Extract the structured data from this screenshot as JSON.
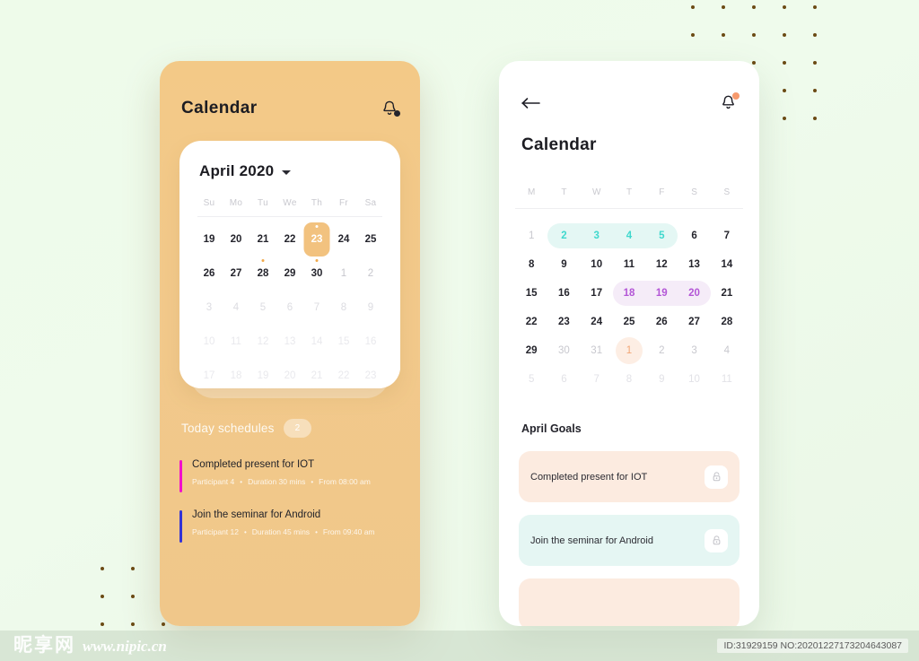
{
  "background": {
    "color": "#effbec",
    "dot_color": "#6b4a14"
  },
  "left_phone": {
    "accent_bg": "#f2c987",
    "title": "Calendar",
    "bell_icon": "bell-icon",
    "calendar": {
      "month_label": "April 2020",
      "dropdown_icon": "chevron-down-icon",
      "weekdays": [
        "Su",
        "Mo",
        "Tu",
        "We",
        "Th",
        "Fr",
        "Sa"
      ],
      "rows": [
        [
          {
            "n": "19",
            "style": "normal"
          },
          {
            "n": "20",
            "style": "normal"
          },
          {
            "n": "21",
            "style": "normal"
          },
          {
            "n": "22",
            "style": "normal"
          },
          {
            "n": "23",
            "style": "selected",
            "dot": true
          },
          {
            "n": "24",
            "style": "normal"
          },
          {
            "n": "25",
            "style": "normal"
          }
        ],
        [
          {
            "n": "26",
            "style": "normal"
          },
          {
            "n": "27",
            "style": "normal"
          },
          {
            "n": "28",
            "style": "normal",
            "dot": true
          },
          {
            "n": "29",
            "style": "normal"
          },
          {
            "n": "30",
            "style": "normal",
            "dot": true
          },
          {
            "n": "1",
            "style": "muted"
          },
          {
            "n": "2",
            "style": "muted"
          }
        ],
        [
          {
            "n": "3",
            "style": "faint"
          },
          {
            "n": "4",
            "style": "faint"
          },
          {
            "n": "5",
            "style": "faint"
          },
          {
            "n": "6",
            "style": "faint"
          },
          {
            "n": "7",
            "style": "faint"
          },
          {
            "n": "8",
            "style": "faint"
          },
          {
            "n": "9",
            "style": "faint"
          }
        ],
        [
          {
            "n": "10",
            "style": "fainter"
          },
          {
            "n": "11",
            "style": "fainter"
          },
          {
            "n": "12",
            "style": "fainter"
          },
          {
            "n": "13",
            "style": "fainter"
          },
          {
            "n": "14",
            "style": "fainter"
          },
          {
            "n": "15",
            "style": "fainter"
          },
          {
            "n": "16",
            "style": "fainter"
          }
        ],
        [
          {
            "n": "17",
            "style": "fainter"
          },
          {
            "n": "18",
            "style": "fainter"
          },
          {
            "n": "19",
            "style": "fainter"
          },
          {
            "n": "20",
            "style": "fainter"
          },
          {
            "n": "21",
            "style": "fainter"
          },
          {
            "n": "22",
            "style": "fainter"
          },
          {
            "n": "23",
            "style": "fainter"
          }
        ]
      ]
    },
    "schedules_section": {
      "title": "Today schedules",
      "count": "2",
      "items": [
        {
          "name": "Completed present for IOT",
          "participant": "Participant  4",
          "duration": "Duration 30 mins",
          "from": "From  08:00 am",
          "accent": "#f20fcc"
        },
        {
          "name": "Join the seminar for Android",
          "participant": "Participant  12",
          "duration": "Duration 45 mins",
          "from": "From  09:40 am",
          "accent": "#3333d6"
        }
      ]
    }
  },
  "right_phone": {
    "back_icon": "arrow-left-icon",
    "bell_icon": "bell-icon",
    "title": "Calendar",
    "calendar": {
      "weekdays": [
        "M",
        "T",
        "W",
        "T",
        "F",
        "S",
        "S"
      ],
      "rows": [
        [
          {
            "n": "1",
            "style": "muted"
          },
          {
            "n": "2",
            "style": "teal"
          },
          {
            "n": "3",
            "style": "teal"
          },
          {
            "n": "4",
            "style": "teal"
          },
          {
            "n": "5",
            "style": "teal"
          },
          {
            "n": "6",
            "style": "normal"
          },
          {
            "n": "7",
            "style": "normal"
          }
        ],
        [
          {
            "n": "8",
            "style": "normal"
          },
          {
            "n": "9",
            "style": "normal"
          },
          {
            "n": "10",
            "style": "normal"
          },
          {
            "n": "11",
            "style": "normal"
          },
          {
            "n": "12",
            "style": "normal"
          },
          {
            "n": "13",
            "style": "normal"
          },
          {
            "n": "14",
            "style": "normal"
          }
        ],
        [
          {
            "n": "15",
            "style": "normal"
          },
          {
            "n": "16",
            "style": "normal"
          },
          {
            "n": "17",
            "style": "normal"
          },
          {
            "n": "18",
            "style": "purple"
          },
          {
            "n": "19",
            "style": "purple"
          },
          {
            "n": "20",
            "style": "purple"
          },
          {
            "n": "21",
            "style": "normal"
          }
        ],
        [
          {
            "n": "22",
            "style": "normal"
          },
          {
            "n": "23",
            "style": "normal"
          },
          {
            "n": "24",
            "style": "normal"
          },
          {
            "n": "25",
            "style": "normal"
          },
          {
            "n": "26",
            "style": "normal"
          },
          {
            "n": "27",
            "style": "normal"
          },
          {
            "n": "28",
            "style": "normal"
          }
        ],
        [
          {
            "n": "29",
            "style": "normal"
          },
          {
            "n": "30",
            "style": "muted"
          },
          {
            "n": "31",
            "style": "muted"
          },
          {
            "n": "1",
            "style": "peach"
          },
          {
            "n": "2",
            "style": "muted"
          },
          {
            "n": "3",
            "style": "muted"
          },
          {
            "n": "4",
            "style": "muted"
          }
        ],
        [
          {
            "n": "5",
            "style": "faint"
          },
          {
            "n": "6",
            "style": "faint"
          },
          {
            "n": "7",
            "style": "faint"
          },
          {
            "n": "8",
            "style": "faint"
          },
          {
            "n": "9",
            "style": "faint"
          },
          {
            "n": "10",
            "style": "faint"
          },
          {
            "n": "11",
            "style": "faint"
          }
        ]
      ],
      "highlight_colors": {
        "teal_bg": "#e4f7f4",
        "teal_text": "#3fd8cd",
        "purple_bg": "#f5ecf8",
        "purple_text": "#b356d6",
        "peach_bg": "#fdeee4",
        "peach_text": "#f2a675"
      }
    },
    "goals_section": {
      "title": "April Goals",
      "items": [
        {
          "label": "Completed present for IOT",
          "theme": "peach",
          "icon": "lock-icon"
        },
        {
          "label": "Join the seminar for Android",
          "theme": "mint",
          "icon": "lock-icon"
        },
        {
          "label": "",
          "theme": "peach",
          "icon": "lock-icon"
        }
      ]
    }
  },
  "watermark": {
    "brand_cn": "昵享网",
    "url": "www.nipic.cn",
    "id_text": "ID:31929159 NO:20201227173204643087"
  }
}
